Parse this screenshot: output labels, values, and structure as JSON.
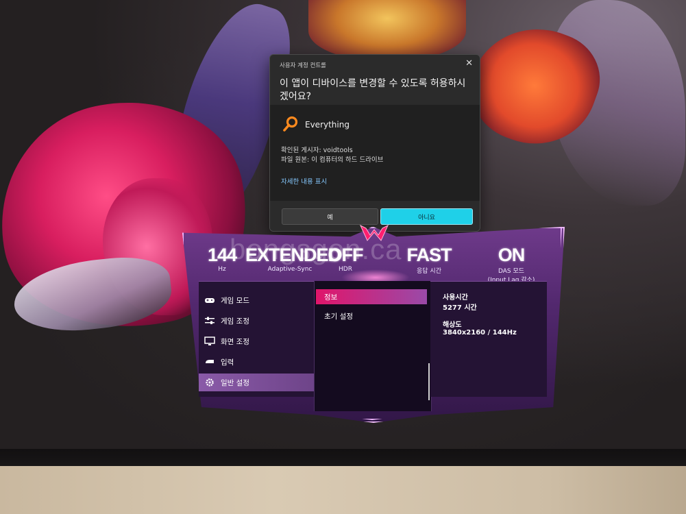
{
  "uac": {
    "caption": "사용자 계정 컨트롤",
    "close": "✕",
    "heading": "이 앱이 디바이스를 변경할 수 있도록 허용하시겠어요?",
    "app_name": "Everything",
    "publisher": "확인된 게시자: voidtools",
    "origin": "파일 원본: 이 컴퓨터의 하드 드라이브",
    "details": "자세한 내용 표시",
    "yes": "예",
    "no": "아니요",
    "accent": "#1fd0e8"
  },
  "osd": {
    "stats": [
      {
        "big": "144",
        "sub": "Hz"
      },
      {
        "big": "EXTENDED",
        "sub": "Adaptive-Sync"
      },
      {
        "big": "OFF",
        "sub": "HDR"
      },
      {
        "big": "FAST",
        "sub": "응답 시간"
      },
      {
        "big": "ON",
        "sub": "DAS 모드",
        "sub2": "(Input Lag 감소)"
      }
    ],
    "menu": [
      {
        "label": "게임 모드",
        "icon": "gamepad-icon"
      },
      {
        "label": "게임 조정",
        "icon": "sliders-icon"
      },
      {
        "label": "화면 조정",
        "icon": "monitor-icon"
      },
      {
        "label": "입력",
        "icon": "input-icon"
      },
      {
        "label": "일반 설정",
        "icon": "gear-icon",
        "active": true
      }
    ],
    "submenu": [
      {
        "label": "정보",
        "active": true
      },
      {
        "label": "초기 설정"
      }
    ],
    "info": {
      "usage_label": "사용시간",
      "usage_value": "5277 시간",
      "res_label": "해상도",
      "res_value": "3840x2160 / 144Hz"
    },
    "accent": "#e0156a"
  },
  "watermark": "bongsgon.ca"
}
